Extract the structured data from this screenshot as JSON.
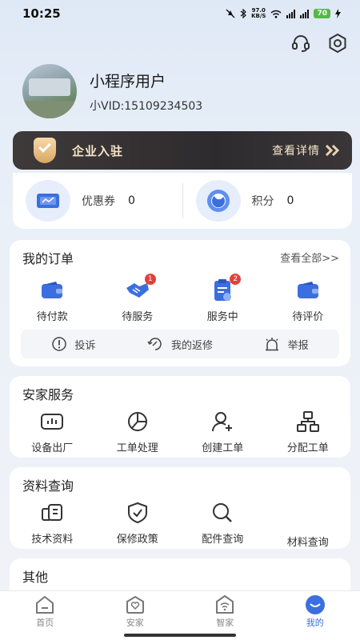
{
  "status_bar": {
    "time": "10:25",
    "net_speed_value": "97.0",
    "net_speed_unit": "KB/S",
    "network": "5G",
    "battery": "70"
  },
  "profile": {
    "username": "小程序用户",
    "vid": "小VID:15109234503"
  },
  "banner": {
    "title": "企业入驻",
    "link": "查看详情"
  },
  "assets": [
    {
      "label": "优惠券",
      "value": "0",
      "icon": "coupon-icon"
    },
    {
      "label": "积分",
      "value": "0",
      "icon": "points-icon"
    }
  ],
  "orders": {
    "title": "我的订单",
    "view_all": "查看全部>>",
    "items": [
      {
        "label": "待付款",
        "icon": "wallet-icon",
        "badge": ""
      },
      {
        "label": "待服务",
        "icon": "handshake-icon",
        "badge": "1"
      },
      {
        "label": "服务中",
        "icon": "clipboard-icon",
        "badge": "2"
      },
      {
        "label": "待评价",
        "icon": "wallet-icon",
        "badge": ""
      }
    ],
    "sub_actions": [
      {
        "label": "投诉",
        "icon": "exclamation-icon"
      },
      {
        "label": "我的返修",
        "icon": "repair-icon"
      },
      {
        "label": "举报",
        "icon": "alarm-icon"
      }
    ]
  },
  "install_service": {
    "title": "安家服务",
    "items": [
      {
        "label": "设备出厂",
        "icon": "chart-box-icon"
      },
      {
        "label": "工单处理",
        "icon": "pie-chart-icon"
      },
      {
        "label": "创建工单",
        "icon": "add-user-icon"
      },
      {
        "label": "分配工单",
        "icon": "org-chart-icon"
      }
    ]
  },
  "docs": {
    "title": "资料查询",
    "items": [
      {
        "label": "技术资料",
        "icon": "document-icon"
      },
      {
        "label": "保修政策",
        "icon": "shield-check-icon"
      },
      {
        "label": "配件查询",
        "icon": "search-icon"
      },
      {
        "label": "材料查询",
        "icon": ""
      }
    ]
  },
  "other": {
    "title": "其他"
  },
  "tabbar": [
    {
      "label": "首页",
      "icon": "home-icon",
      "active": false
    },
    {
      "label": "安家",
      "icon": "house-heart-icon",
      "active": false
    },
    {
      "label": "智家",
      "icon": "smart-home-icon",
      "active": false
    },
    {
      "label": "我的",
      "icon": "profile-icon",
      "active": true
    }
  ],
  "colors": {
    "accent": "#3b6fe0",
    "badge": "#e2413b",
    "banner_bg": "#2e2b2e",
    "banner_text": "#f6e6c8"
  }
}
